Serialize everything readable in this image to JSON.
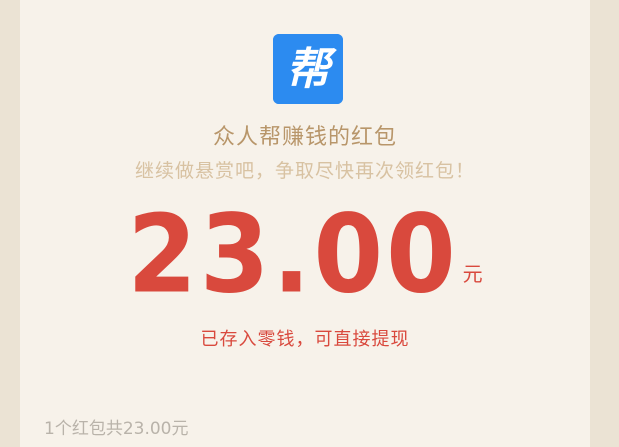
{
  "logo": {
    "icon": "bang-app-logo",
    "text": "帮",
    "color": "#2c8bf0"
  },
  "title": "众人帮赚钱的红包",
  "subtitle": "继续做悬赏吧，争取尽快再次领红包！",
  "amount": {
    "value": "23.00",
    "unit": "元",
    "color": "#d9493d"
  },
  "note": "已存入零钱，可直接提现",
  "summary": "1个红包共23.00元",
  "colors": {
    "background": "#f7f2ea",
    "title": "#b8966a",
    "subtitle": "#d8c2a2"
  }
}
